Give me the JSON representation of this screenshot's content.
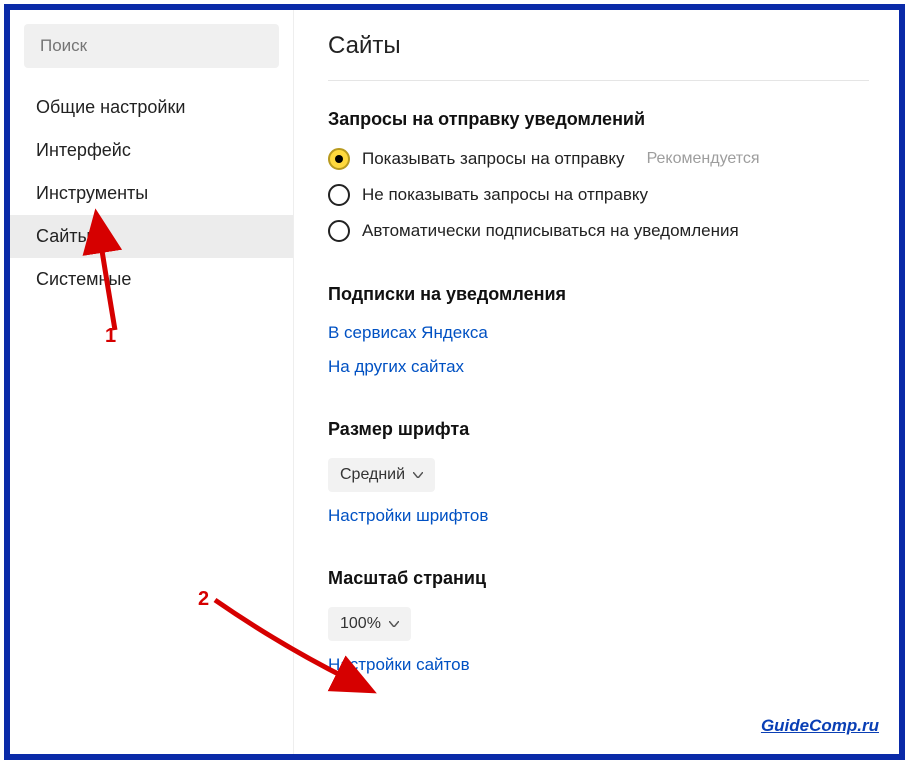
{
  "sidebar": {
    "search_placeholder": "Поиск",
    "items": [
      {
        "label": "Общие настройки",
        "active": false
      },
      {
        "label": "Интерфейс",
        "active": false
      },
      {
        "label": "Инструменты",
        "active": false
      },
      {
        "label": "Сайты",
        "active": true
      },
      {
        "label": "Системные",
        "active": false
      }
    ]
  },
  "main": {
    "title": "Сайты",
    "notifications": {
      "heading": "Запросы на отправку уведомлений",
      "options": [
        {
          "label": "Показывать запросы на отправку",
          "hint": "Рекомендуется",
          "selected": true
        },
        {
          "label": "Не показывать запросы на отправку",
          "hint": "",
          "selected": false
        },
        {
          "label": "Автоматически подписываться на уведомления",
          "hint": "",
          "selected": false
        }
      ]
    },
    "subscriptions": {
      "heading": "Подписки на уведомления",
      "links": [
        "В сервисах Яндекса",
        "На других сайтах"
      ]
    },
    "font_size": {
      "heading": "Размер шрифта",
      "value": "Средний",
      "link": "Настройки шрифтов"
    },
    "page_scale": {
      "heading": "Масштаб страниц",
      "value": "100%",
      "link": "Настройки сайтов"
    }
  },
  "watermark": "GuideComp.ru",
  "annotations": {
    "one": "1",
    "two": "2"
  }
}
